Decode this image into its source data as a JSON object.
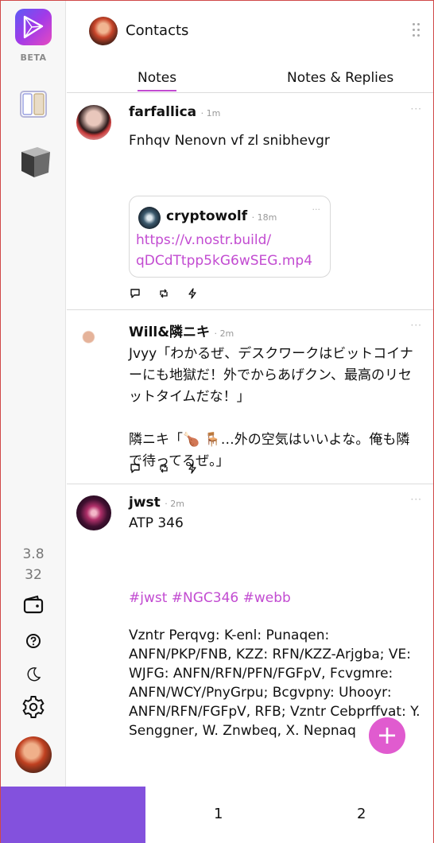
{
  "rail": {
    "beta_label": "BETA",
    "version_line1": "3.8",
    "version_line2": "32"
  },
  "header": {
    "title": "Contacts",
    "tabs": [
      {
        "label": "Notes",
        "active": true
      },
      {
        "label": "Notes & Replies",
        "active": false
      }
    ]
  },
  "posts": [
    {
      "author": "farfallica",
      "age": "1m",
      "text": "Fnhqv Nenovn vf zl snibhevgr",
      "quote": {
        "author": "cryptowolf",
        "age": "18m",
        "link": "https://v.nostr.build/\nqDCdTtpp5kG6wSEG.mp4"
      }
    },
    {
      "author": "Will&隣ニキ",
      "age": "2m",
      "text": "Jvyy「わかるぜ、デスクワークはビットコイナーにも地獄だ！外でからあげクン、最高のリセットタイムだな！」\n\n隣ニキ「🍗 🪑…外の空気はいいよな。俺も隣で待ってるぜ。」"
    },
    {
      "author": "jwst",
      "age": "2m",
      "text_top": "ATP 346",
      "hashtags": "#jwst #NGC346 #webb",
      "text_bottom": "Vzntr Perqvg: K-enl: Punaqen: ANFN/PKP/FNB, KZZ: RFN/KZZ-Arjgba; VE: WJFG: ANFN/RFN/PFN/FGFpV, Fcvgmre: ANFN/WCY/PnyGrpu; Bcgvpny: Uhooyr: ANFN/RFN/FGFpV, RFB; Vzntr Cebprffvat: Y. Senggner, W. Znwbeq, X. Nepnaq"
    }
  ],
  "fab": {
    "label": "+"
  },
  "bottom_bar": {
    "tabs": [
      "",
      "1",
      "2"
    ],
    "active_color": "#8351dd"
  },
  "colors": {
    "accent": "#c24bd1",
    "fab": "#e05bcf"
  }
}
